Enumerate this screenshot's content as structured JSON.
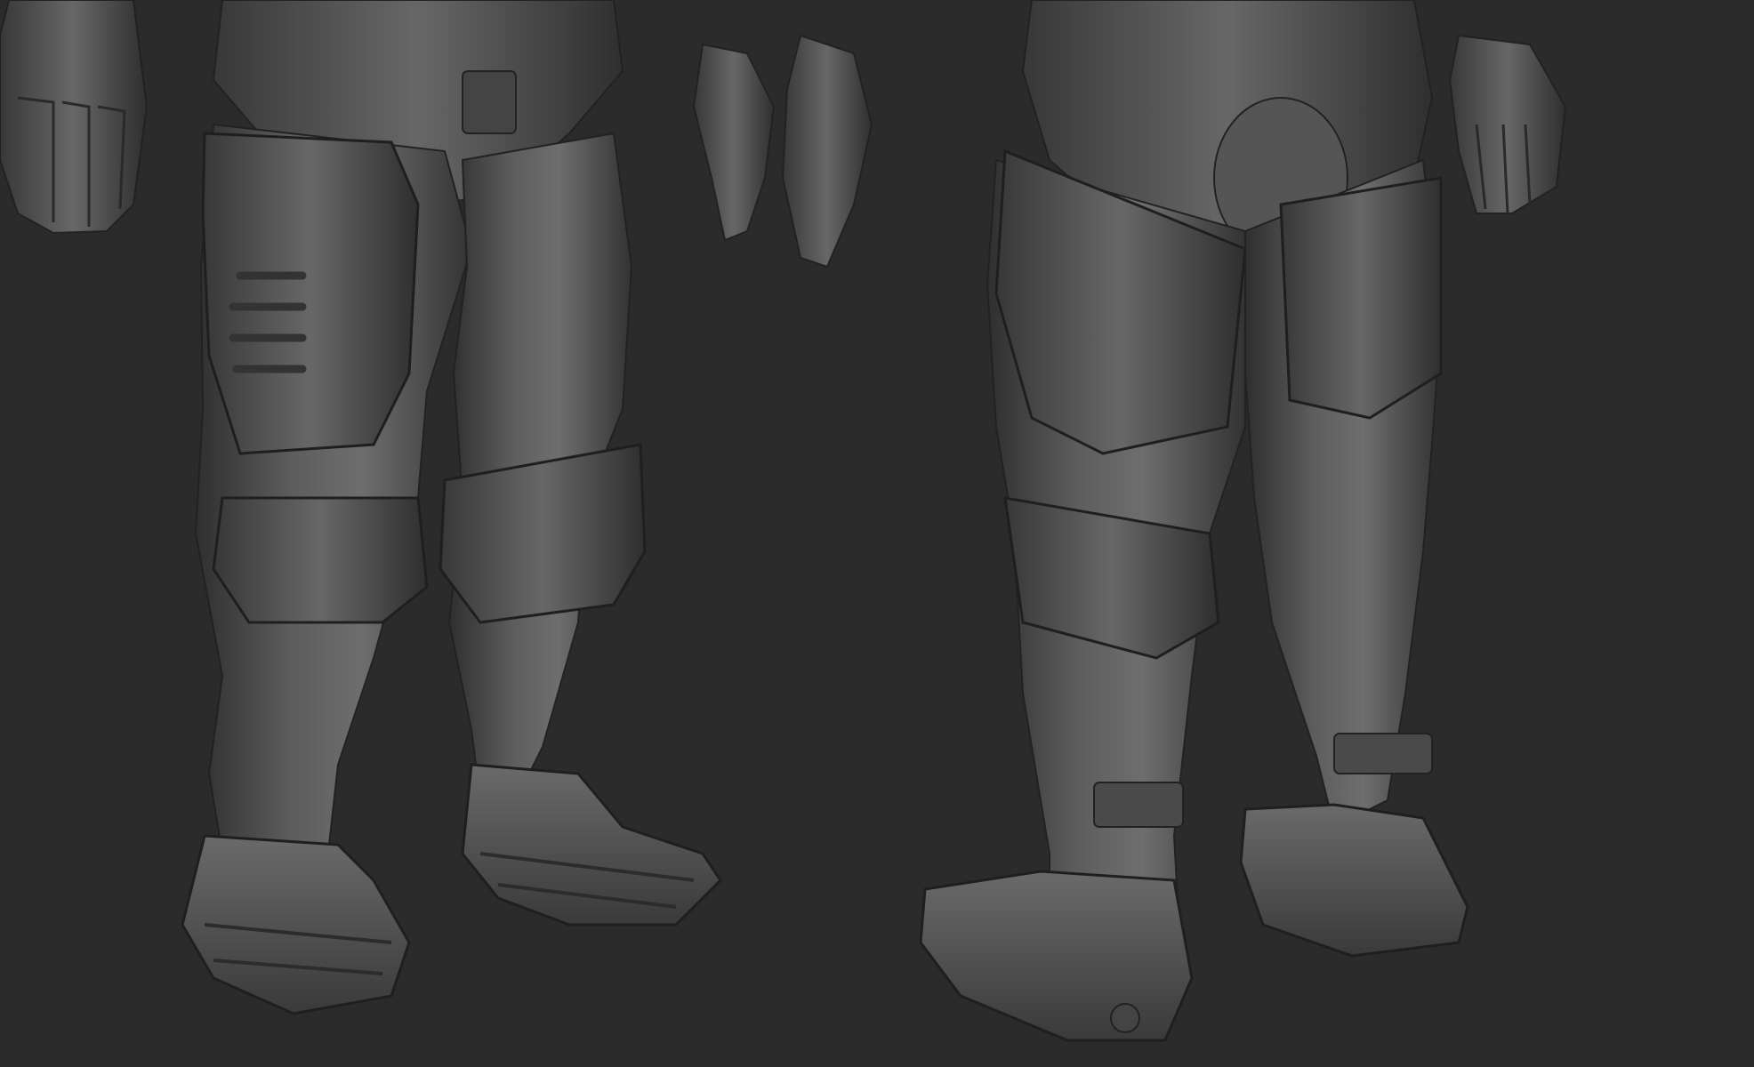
{
  "scene": {
    "background": "#2b2b2b",
    "material": "matcap-grey",
    "views": [
      "front-three-quarter",
      "back-three-quarter"
    ]
  }
}
